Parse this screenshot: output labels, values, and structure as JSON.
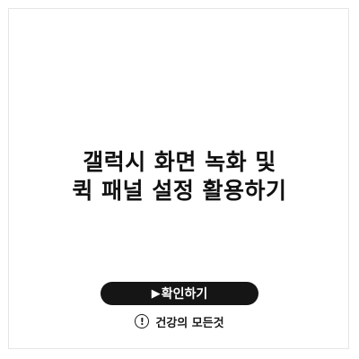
{
  "article": {
    "title_line1": "갤럭시 화면 녹화 및",
    "title_line2": "퀵 패널 설정 활용하기"
  },
  "cta": {
    "icon": "play-triangle",
    "play_glyph": "▶",
    "label": "확인하기",
    "background": "#151515",
    "text_color": "#ffffff"
  },
  "footer": {
    "icon": "exclamation-circle",
    "icon_glyph": "!",
    "brand": "건강의 모든것"
  }
}
